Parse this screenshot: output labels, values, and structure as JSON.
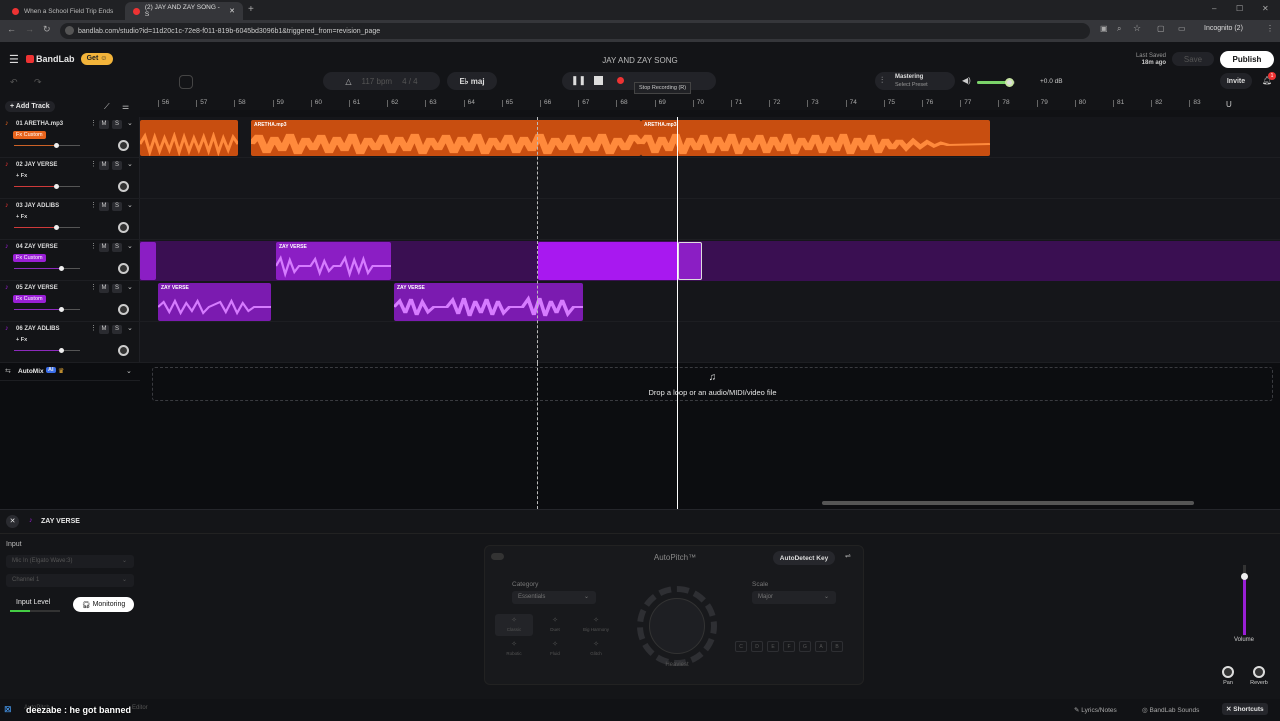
{
  "browser": {
    "tabs": [
      {
        "title": "When a School Field Trip Ends"
      },
      {
        "title": "(2) JAY AND ZAY SONG - S"
      }
    ],
    "url": "bandlab.com/studio?id=11d20c1c-72e8-f011-819b-6045bd3096b1&triggered_from=revision_page",
    "profile": "Incognito (2)"
  },
  "header": {
    "brand": "BandLab",
    "get_label": "Get",
    "project_title": "JAY AND ZAY SONG",
    "last_saved_label": "Last Saved",
    "last_saved_time": "18m ago",
    "save_label": "Save",
    "publish_label": "Publish",
    "invite_label": "Invite",
    "notification_count": "1"
  },
  "transport": {
    "bpm": "117",
    "bpm_unit": "bpm",
    "time_sig": "4 / 4",
    "key": "E♭ maj",
    "tooltip": "Stop Recording (R)",
    "mastering_label": "Mastering",
    "mastering_preset": "Select Preset",
    "master_db": "+0.0 dB",
    "master_volume": 0.85
  },
  "toolbar": {
    "add_track_label": "Add Track"
  },
  "ruler": [
    "56",
    "57",
    "58",
    "59",
    "60",
    "61",
    "62",
    "63",
    "64",
    "65",
    "66",
    "67",
    "68",
    "69",
    "70",
    "71",
    "72",
    "73",
    "74",
    "75",
    "76",
    "77",
    "78",
    "79",
    "80",
    "81",
    "82",
    "83"
  ],
  "tracks": [
    {
      "number": "01",
      "name": "ARETHA.mp3",
      "fx": "Fx Custom",
      "color": "#e8641c",
      "volume": 0.9
    },
    {
      "number": "02",
      "name": "JAY VERSE",
      "fx": "+ Fx",
      "color": "#e33",
      "volume": 0.9
    },
    {
      "number": "03",
      "name": "JAY ADLIBS",
      "fx": "+ Fx",
      "color": "#e33",
      "volume": 0.9
    },
    {
      "number": "04",
      "name": "ZAY VERSE",
      "fx": "Fx Custom",
      "color": "#9a1fd6",
      "volume": 1.0
    },
    {
      "number": "05",
      "name": "ZAY VERSE",
      "fx": "Fx Custom",
      "color": "#9a1fd6",
      "volume": 1.0
    },
    {
      "number": "06",
      "name": "ZAY ADLIBS",
      "fx": "+ Fx",
      "color": "#9a1fd6",
      "volume": 1.0
    }
  ],
  "track_buttons": {
    "mute": "M",
    "solo": "S"
  },
  "clips": {
    "aretha_a": "ARETHA.mp3",
    "aretha_b": "ARETHA.mp3",
    "zay_1": "ZAY VERSE",
    "zay_2": "ZAY VERSE",
    "zay_3": "ZAY VERSE"
  },
  "automix": {
    "label": "AutoMix",
    "badge": "AI"
  },
  "dropzone": {
    "text": "Drop a loop or an audio/MIDI/video file"
  },
  "panel": {
    "track_name": "ZAY VERSE",
    "input_label": "Input",
    "input_device": "Mic In (Elgato Wave:3)",
    "channel": "Channel 1",
    "input_level_label": "Input Level",
    "monitoring_label": "Monitoring",
    "autopitch_title": "AutoPitch™",
    "autodetect_label": "AutoDetect Key",
    "category_label": "Category",
    "category_value": "Essentials",
    "scale_label": "Scale",
    "scale_value": "Major",
    "effects": [
      "Classic",
      "Duet",
      "Big Harmony",
      "Robotic",
      "Fluid",
      "Glitch"
    ],
    "dial_label": "Heaviest",
    "keys": [
      "C",
      "D",
      "E",
      "F",
      "G",
      "A",
      "B"
    ],
    "volume_label": "Volume",
    "pan_label": "Pan",
    "reverb_label": "Reverb",
    "footer": {
      "autopitch": "AutoPitch",
      "editor": "Editor",
      "lyrics": "Lyrics/Notes",
      "sounds": "BandLab Sounds",
      "shortcuts": "Shortcuts"
    }
  },
  "overlay_caption": "deezabe : he got banned"
}
